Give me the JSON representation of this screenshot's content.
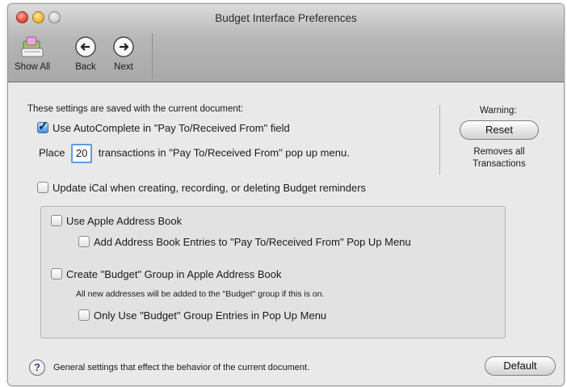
{
  "window": {
    "title": "Budget Interface Preferences"
  },
  "toolbar": {
    "show_all": "Show All",
    "back": "Back",
    "next": "Next"
  },
  "settings": {
    "saved_note": "These settings are saved with the current document:",
    "autocomplete_label": "Use AutoComplete in \"Pay To/Received From\" field",
    "autocomplete_checked": true,
    "place_prefix": "Place",
    "place_value": "20",
    "place_suffix": "transactions in \"Pay To/Received From\" pop up menu."
  },
  "warning": {
    "label": "Warning:",
    "reset_button": "Reset",
    "removes_line1": "Removes all",
    "removes_line2": "Transactions"
  },
  "ical": {
    "label": "Update iCal when creating, recording, or deleting Budget reminders",
    "checked": false
  },
  "address_book": {
    "use_label": "Use Apple Address Book",
    "use_checked": false,
    "add_entries_label": "Add Address Book Entries to \"Pay To/Received From\" Pop Up Menu",
    "add_entries_checked": false,
    "create_group_label": "Create \"Budget\" Group in Apple Address Book",
    "create_group_checked": false,
    "group_note": "All new addresses will be added to the \"Budget\" group if this is on.",
    "only_group_label": "Only Use \"Budget\" Group Entries in Pop Up Menu",
    "only_group_checked": false
  },
  "footer": {
    "help_symbol": "?",
    "description": "General settings that effect the behavior of the current document.",
    "default_button": "Default"
  }
}
